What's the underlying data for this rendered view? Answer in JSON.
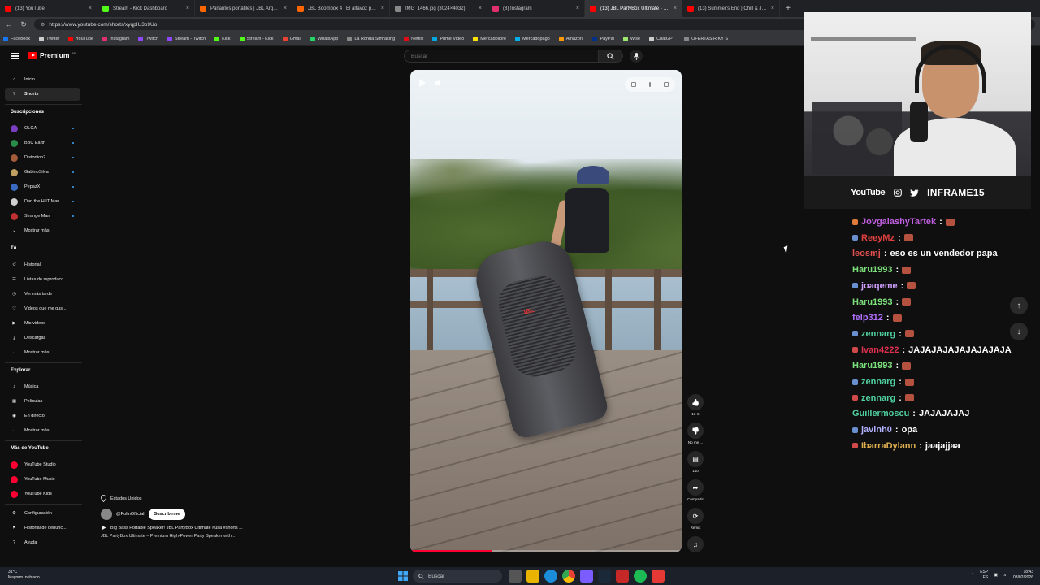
{
  "browser": {
    "tabs": [
      {
        "label": "(13) YouTube",
        "color": "#ff0000"
      },
      {
        "label": "Stream - Kick Dashboard",
        "color": "#53fc18"
      },
      {
        "label": "Parlantes portátiles | JBL Argentina",
        "color": "#ff6600"
      },
      {
        "label": "JBL Boombox 4 | El altavoz portátil",
        "color": "#ff6600"
      },
      {
        "label": "IMG_1466.jpg (3024×4032)",
        "color": "#888888"
      },
      {
        "label": "(8) Instagram",
        "color": "#e1306c"
      },
      {
        "label": "(13) JBL PartyBox Ultimate - Prem",
        "color": "#ff0000"
      },
      {
        "label": "(13) Summer's End | Chill & Jazzh",
        "color": "#ff0000"
      }
    ],
    "url": "https://www.youtube.com/shorts/xyqpIU3o9Uo",
    "bookmarks": [
      {
        "label": "Facebook",
        "color": "#1877f2"
      },
      {
        "label": "Twitter",
        "color": "#cccccc"
      },
      {
        "label": "YouTube",
        "color": "#ff0000"
      },
      {
        "label": "Instagram",
        "color": "#e1306c"
      },
      {
        "label": "Twitch",
        "color": "#9146ff"
      },
      {
        "label": "Stream - Twitch",
        "color": "#9146ff"
      },
      {
        "label": "Kick",
        "color": "#53fc18"
      },
      {
        "label": "Stream - Kick",
        "color": "#53fc18"
      },
      {
        "label": "Gmail",
        "color": "#ea4335"
      },
      {
        "label": "WhatsApp",
        "color": "#25d366"
      },
      {
        "label": "La Ronda Simracing",
        "color": "#888888"
      },
      {
        "label": "Netflix",
        "color": "#e50914"
      },
      {
        "label": "Prime Video",
        "color": "#00a8e1"
      },
      {
        "label": "Mercadolibre",
        "color": "#ffe600"
      },
      {
        "label": "Mercadopago",
        "color": "#00b1ea"
      },
      {
        "label": "Amazon.",
        "color": "#ff9900"
      },
      {
        "label": "PayPal",
        "color": "#003087"
      },
      {
        "label": "Wise",
        "color": "#9fe870"
      },
      {
        "label": "ChatGPT",
        "color": "#cccccc"
      },
      {
        "label": "OFERTAS RIKY S",
        "color": "#888888"
      }
    ]
  },
  "youtube": {
    "logo_text": "Premium",
    "logo_sup": "AR",
    "search_placeholder": "Buscar",
    "sidebar": {
      "main": [
        {
          "label": "Inicio",
          "icon": "home-icon"
        },
        {
          "label": "Shorts",
          "icon": "shorts-icon",
          "active": true
        }
      ],
      "subs_header": "Suscripciones",
      "subs": [
        {
          "label": "OLGA",
          "color": "#7a3fc0"
        },
        {
          "label": "BBC Earth",
          "color": "#2a8a4a"
        },
        {
          "label": "Distortion2",
          "color": "#a35c3a"
        },
        {
          "label": "GabinoSilva",
          "color": "#c0a060"
        },
        {
          "label": "PepazX",
          "color": "#3a6ac0"
        },
        {
          "label": "Dan the HIIT Man",
          "color": "#d0d0d0"
        },
        {
          "label": "Strange Man",
          "color": "#c03030"
        }
      ],
      "subs_more": "Mostrar más",
      "you_header": "Tú",
      "you": [
        {
          "label": "Historial",
          "icon": "history-icon"
        },
        {
          "label": "Listas de reproducc...",
          "icon": "playlist-icon"
        },
        {
          "label": "Ver más tarde",
          "icon": "clock-icon"
        },
        {
          "label": "Videos que me gus...",
          "icon": "like-icon"
        },
        {
          "label": "Mis videos",
          "icon": "video-icon"
        },
        {
          "label": "Descargas",
          "icon": "download-icon"
        },
        {
          "label": "Mostrar más",
          "icon": "chevron-down-icon"
        }
      ],
      "explore_header": "Explorar",
      "explore": [
        {
          "label": "Música",
          "icon": "music-icon"
        },
        {
          "label": "Películas",
          "icon": "film-icon"
        },
        {
          "label": "En directo",
          "icon": "live-icon"
        },
        {
          "label": "Mostrar más",
          "icon": "chevron-down-icon"
        }
      ],
      "more_header": "Más de YouTube",
      "more": [
        {
          "label": "YouTube Studio",
          "color": "#ff0033"
        },
        {
          "label": "YouTube Music",
          "color": "#ff0033"
        },
        {
          "label": "YouTube Kids",
          "color": "#ff0033"
        }
      ],
      "footer": [
        {
          "label": "Configuración",
          "icon": "gear-icon"
        },
        {
          "label": "Historial de denunc...",
          "icon": "flag-icon"
        },
        {
          "label": "Ayuda",
          "icon": "help-icon"
        }
      ]
    },
    "short": {
      "brand_on_speaker": "JBL",
      "progress": 0.3,
      "location": "Estados Unidos",
      "channel": "@PolinOfficial",
      "subscribe": "Suscribirme",
      "title": "Big Bass Portable Speaker! JBL PartyBox Ultimate #usa #shorts ...",
      "subtitle": "JBL PartyBox Ultimate – Premium High-Power Party Speaker with ...",
      "actions": [
        {
          "label": "13 K",
          "icon": "thumbs-up-icon"
        },
        {
          "label": "No me ...",
          "icon": "thumbs-down-icon"
        },
        {
          "label": "140",
          "icon": "comment-icon"
        },
        {
          "label": "Compartir",
          "icon": "share-icon"
        },
        {
          "label": "Remix",
          "icon": "remix-icon"
        },
        {
          "label": "",
          "icon": "sound-thumbnail-icon"
        }
      ]
    }
  },
  "stream": {
    "social_youtube": "YouTube",
    "handle": "INFRAME15",
    "chat": [
      {
        "user": "JovgalashyTartek",
        "color": "#c060e0",
        "msg": "",
        "emote": true
      },
      {
        "user": "ReeyMz",
        "color": "#e04040",
        "msg": "",
        "emote": true
      },
      {
        "user": "leosmj",
        "color": "#e05050",
        "msg": "eso es un vendedor papa",
        "emote": false
      },
      {
        "user": "Haru1993",
        "color": "#7ce07c",
        "msg": "",
        "emote": true
      },
      {
        "user": "joaqeme",
        "color": "#d0a0ff",
        "msg": "",
        "emote": true
      },
      {
        "user": "Haru1993",
        "color": "#7ce07c",
        "msg": "",
        "emote": true
      },
      {
        "user": "felp312",
        "color": "#b070ff",
        "msg": "",
        "emote": true
      },
      {
        "user": "zennarg",
        "color": "#50d0a0",
        "msg": "",
        "emote": true
      },
      {
        "user": "Ivan4222",
        "color": "#e03050",
        "msg": "JAJAJAJAJAJAJAJAJA",
        "emote": false
      },
      {
        "user": "Haru1993",
        "color": "#7ce07c",
        "msg": "",
        "emote": true
      },
      {
        "user": "zennarg",
        "color": "#50d0a0",
        "msg": "",
        "emote": true
      },
      {
        "user": "zennarg",
        "color": "#50d0a0",
        "msg": "",
        "emote": true
      },
      {
        "user": "Guillermoscu",
        "color": "#50d0a0",
        "msg": "JAJAJAJAJ",
        "emote": false
      },
      {
        "user": "javinh0",
        "color": "#b0b0ff",
        "msg": "opa",
        "emote": false
      },
      {
        "user": "IbarraDylann",
        "color": "#e0b050",
        "msg": "jaajajjaa",
        "emote": false
      }
    ]
  },
  "taskbar": {
    "weather_temp": "31°C",
    "weather_desc": "Mayorm. nublado",
    "search": "Buscar",
    "lang1": "ESP",
    "lang2": "ES",
    "time": "18:43",
    "date": "03/02/2026"
  }
}
